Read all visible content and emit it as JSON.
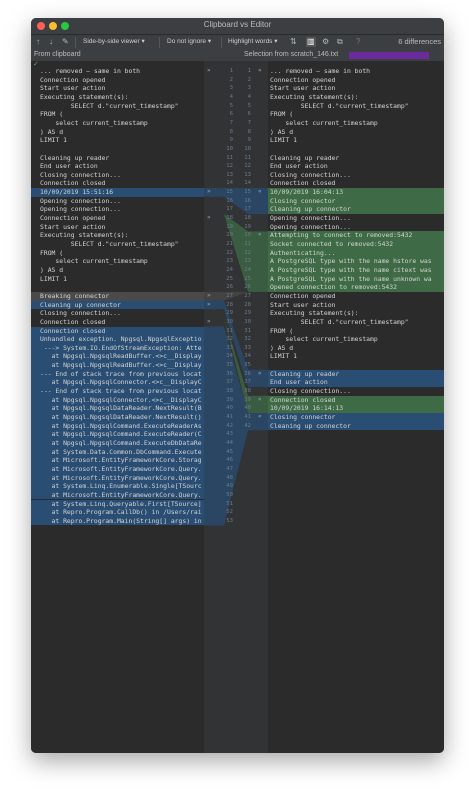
{
  "window": {
    "title": "Clipboard vs Editor"
  },
  "toolbar": {
    "viewer_combo": "Side-by-side viewer ▾",
    "ignore_combo": "Do not ignore ▾",
    "highlight_combo": "Highlight words ▾",
    "differences": "6 differences"
  },
  "headers": {
    "left": "From clipboard",
    "right": "Selection from scratch_146.txt"
  },
  "left_lines": [
    "... removed – same in both",
    "Connection opened",
    "Start user action",
    "Executing statement(s):",
    "        SELECT d.\"current_timestamp\"",
    "FROM (",
    "    select current_timestamp",
    ") AS d",
    "LIMIT 1",
    "",
    "Cleaning up reader",
    "End user action",
    "Closing connection...",
    "Connection closed",
    "10/09/2019 15:51:16",
    "Opening connection...",
    "Opening connection...",
    "Connection opened",
    "Start user action",
    "Executing statement(s):",
    "        SELECT d.\"current_timestamp\"",
    "FROM (",
    "    select current_timestamp",
    ") AS d",
    "LIMIT 1",
    "",
    "Breaking connector",
    "Cleaning up connector",
    "Closing connection...",
    "Connection closed",
    "Connection closed",
    "Unhandled exception. Npgsql.NpgsqlExceptio",
    " ---> System.IO.EndOfStreamException: Atte",
    "   at Npgsql.NpgsqlReadBuffer.<>c__Display",
    "   at Npgsql.NpgsqlReadBuffer.<>c__Display",
    "--- End of stack trace from previous locat",
    "   at Npgsql.NpgsqlConnector.<>c__DisplayC",
    "--- End of stack trace from previous locat",
    "   at Npgsql.NpgsqlConnector.<>c__DisplayC",
    "   at Npgsql.NpgsqlDataReader.NextResult(B",
    "   at Npgsql.NpgsqlDataReader.NextResult()",
    "   at Npgsql.NpgsqlCommand.ExecuteReaderAs",
    "   at Npgsql.NpgsqlCommand.ExecuteReader(C",
    "   at Npgsql.NpgsqlCommand.ExecuteDbDataRe",
    "   at System.Data.Common.DbCommand.Execute",
    "   at Microsoft.EntityFrameworkCore.Storag",
    "   at Microsoft.EntityFrameworkCore.Query.",
    "   at Microsoft.EntityFrameworkCore.Query.",
    "   at System.Linq.Enumerable.Single[TSourc",
    "   at Microsoft.EntityFrameworkCore.Query.",
    "   at System.Linq.Queryable.First[TSource]",
    "   at Repro.Program.CallDb() in /Users/rai",
    "   at Repro.Program.Main(String[] args) in"
  ],
  "left_numbers": [
    "1",
    "2",
    "3",
    "4",
    "5",
    "6",
    "7",
    "8",
    "9",
    "10",
    "11",
    "12",
    "13",
    "14",
    "15",
    "16",
    "17",
    "18",
    "19",
    "20",
    "21",
    "22",
    "23",
    "24",
    "25",
    "26",
    "27",
    "28",
    "29",
    "30",
    "31",
    "32",
    "33",
    "34",
    "35",
    "36",
    "37",
    "38",
    "39",
    "40",
    "41",
    "42",
    "43",
    "44",
    "45",
    "46",
    "47",
    "48",
    "49",
    "50",
    "51",
    "52",
    "53"
  ],
  "right_lines": [
    "... removed – same in both",
    "Connection opened",
    "Start user action",
    "Executing statement(s):",
    "        SELECT d.\"current_timestamp\"",
    "FROM (",
    "    select current_timestamp",
    ") AS d",
    "LIMIT 1",
    "",
    "Cleaning up reader",
    "End user action",
    "Closing connection...",
    "Connection closed",
    "10/09/2019 16:04:13",
    "Closing connector",
    "Cleaning up connector",
    "Opening connection...",
    "Opening connection...",
    "Attempting to connect to removed:5432",
    "Socket connected to removed:5432",
    "Authenticating...",
    "A PostgreSQL type with the name hstore was",
    "A PostgreSQL type with the name citext was",
    "A PostgreSQL type with the name unknown wa",
    "Opened connection to removed:5432",
    "Connection opened",
    "Start user action",
    "Executing statement(s):",
    "        SELECT d.\"current_timestamp\"",
    "FROM (",
    "    select current_timestamp",
    ") AS d",
    "LIMIT 1",
    "",
    "Cleaning up reader",
    "End user action",
    "Closing connection...",
    "Connection closed",
    "10/09/2019 16:14:13",
    "Closing connector",
    "Cleaning up connector"
  ],
  "right_numbers": [
    "1",
    "2",
    "3",
    "4",
    "5",
    "6",
    "7",
    "8",
    "9",
    "10",
    "11",
    "12",
    "13",
    "14",
    "15",
    "16",
    "17",
    "18",
    "19",
    "20",
    "21",
    "22",
    "23",
    "24",
    "25",
    "26",
    "27",
    "28",
    "29",
    "30",
    "31",
    "32",
    "33",
    "34",
    "35",
    "36",
    "37",
    "38",
    "39",
    "40",
    "41",
    "42"
  ],
  "colors": {
    "changed": "#294d73",
    "inserted": "#3e6b45",
    "separator": "#4a4a4a",
    "background": "#2b2b2b"
  }
}
